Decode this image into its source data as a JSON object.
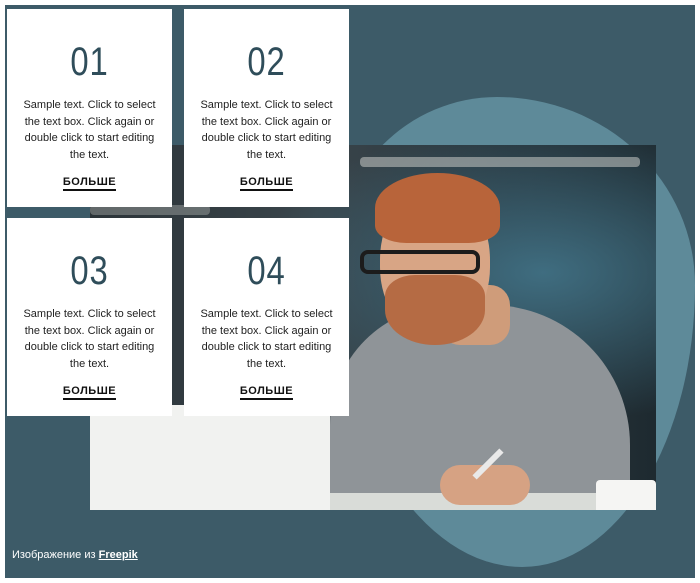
{
  "cards": [
    {
      "number": "01",
      "text": "Sample text. Click to select the text box. Click again or double click to start editing the text.",
      "link": "БОЛЬШЕ"
    },
    {
      "number": "02",
      "text": "Sample text. Click to select the text box. Click again or double click to start editing the text.",
      "link": "БОЛЬШЕ"
    },
    {
      "number": "03",
      "text": "Sample text. Click to select the text box. Click again or double click to start editing the text.",
      "link": "БОЛЬШЕ"
    },
    {
      "number": "04",
      "text": "Sample text. Click to select the text box. Click again or double click to start editing the text.",
      "link": "БОЛЬШЕ"
    }
  ],
  "credit": {
    "prefix": "Изображение из",
    "link": "Freepik"
  },
  "colors": {
    "background": "#3d5b68",
    "blob": "#5e8a99",
    "number": "#2f4d5a"
  }
}
